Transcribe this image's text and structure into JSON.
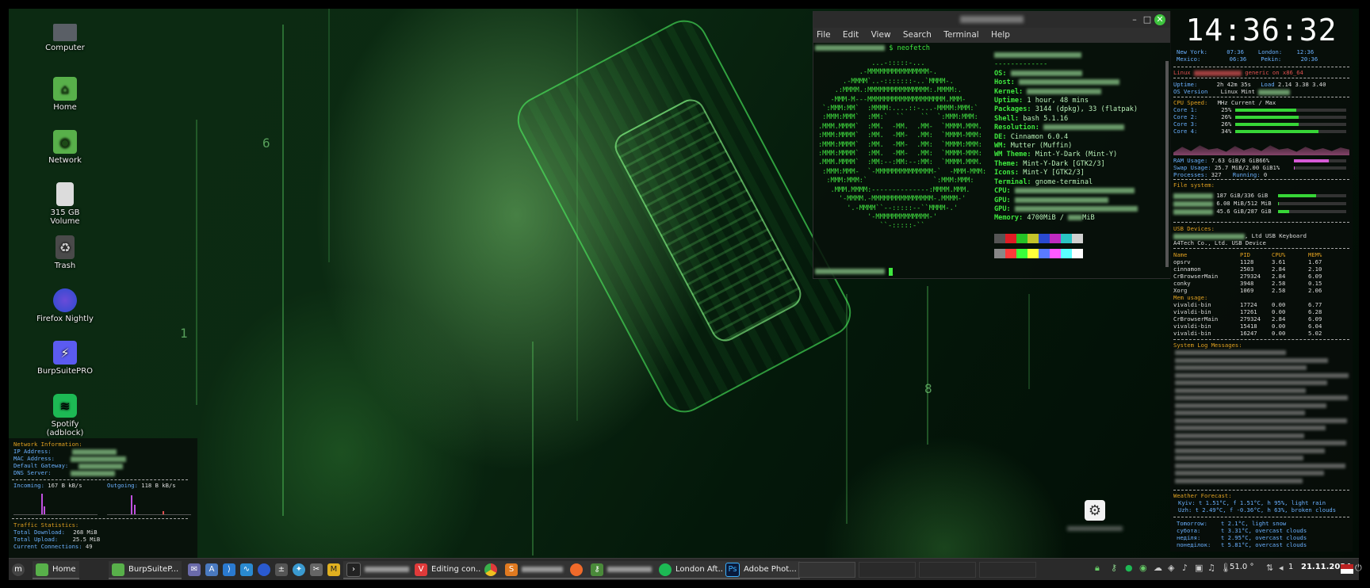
{
  "desktop": {
    "icons": [
      {
        "label": "Computer"
      },
      {
        "label": "Home"
      },
      {
        "label": "Network"
      },
      {
        "label": "315 GB Volume"
      },
      {
        "label": "Trash"
      },
      {
        "label": "Firefox Nightly"
      },
      {
        "label": "BurpSuitePRO"
      },
      {
        "label": "Spotify (adblock)"
      }
    ]
  },
  "terminal": {
    "menu": [
      "File",
      "Edit",
      "View",
      "Search",
      "Terminal",
      "Help"
    ],
    "command": "$ neofetch",
    "ascii": "             ...-:::::-...\n          .-MMMMMMMMMMMMMMM-.\n      .-MMMM`..-:::::::-..`MMMM-.\n    .:MMMM.:MMMMMMMMMMMMMMM:.MMMM:.\n   -MMM-M---MMMMMMMMMMMMMMMMMMM.MMM-\n `:MMM:MM`  :MMMM:....::-...-MMMM:MMM:`\n :MMM:MMM`  :MM:`  ``    ``  `:MMM:MMM:\n.MMM.MMMM`  :MM.  -MM.  .MM-  `MMMM.MMM.\n:MMM:MMMM`  :MM.  -MM-  .MM:  `MMMM-MMM:\n:MMM:MMMM`  :MM.  -MM-  .MM:  `MMMM:MMM:\n:MMM:MMMM`  :MM.  -MM-  .MM:  `MMMM-MMM:\n.MMM.MMMM`  :MM:--:MM:--:MM:  `MMMM.MMM.\n :MMM:MMM-  `-MMMMMMMMMMMMMM-`  -MMM-MMM:\n  :MMM:MMM:`                `:MMM:MMM:\n   .MMM.MMMM:--------------:MMMM.MMM.\n     '-MMMM.-MMMMMMMMMMMMMMM-.MMMM-'\n       '.-MMMM``--:::::--``MMMM-.'\n            '-MMMMMMMMMMMMM-'\n               ``-:::::-``",
    "info": [
      {
        "k": "OS:",
        "v": ""
      },
      {
        "k": "Host:",
        "v": ""
      },
      {
        "k": "Kernel:",
        "v": ""
      },
      {
        "k": "Uptime:",
        "v": "1 hour, 48 mins"
      },
      {
        "k": "Packages:",
        "v": "3144 (dpkg), 33 (flatpak)"
      },
      {
        "k": "Shell:",
        "v": "bash 5.1.16"
      },
      {
        "k": "Resolution:",
        "v": ""
      },
      {
        "k": "DE:",
        "v": "Cinnamon 6.0.4"
      },
      {
        "k": "WM:",
        "v": "Mutter (Muffin)"
      },
      {
        "k": "WM Theme:",
        "v": "Mint-Y-Dark (Mint-Y)"
      },
      {
        "k": "Theme:",
        "v": "Mint-Y-Dark [GTK2/3]"
      },
      {
        "k": "Icons:",
        "v": "Mint-Y [GTK2/3]"
      },
      {
        "k": "Terminal:",
        "v": "gnome-terminal"
      },
      {
        "k": "CPU:",
        "v": ""
      },
      {
        "k": "GPU:",
        "v": ""
      },
      {
        "k": "GPU:",
        "v": ""
      },
      {
        "k": "Memory:",
        "v": "4700MiB / "
      }
    ],
    "memory_suffix": "MiB",
    "palette": [
      "#555555",
      "#e01b24",
      "#26c226",
      "#c4c42a",
      "#2a4ad0",
      "#c02ac0",
      "#2ac4c4",
      "#d0d0d0"
    ],
    "palette2": [
      "#888888",
      "#ff3a3a",
      "#3aff3a",
      "#ffff3a",
      "#5a7aff",
      "#ff5aff",
      "#5affff",
      "#ffffff"
    ]
  },
  "conky_right": {
    "clock": "14:36:32",
    "cities": [
      {
        "name": "New York:",
        "time": "07:36",
        "name2": "London:",
        "time2": "12:36"
      },
      {
        "name": "Mexico:",
        "time": "06:36",
        "name2": "Pekin:",
        "time2": "20:36"
      }
    ],
    "kernel_prefix": "Linux",
    "kernel_suffix": "generic on x86_64",
    "uptime_label": "Uptime:",
    "uptime": "2h 42m 35s",
    "load_label": "Load",
    "load": "2.14 3.38 3.40",
    "os_label": "OS Version",
    "os": "Linux Mint",
    "cpu_header": "CPU Speed:",
    "cpu_cols": "MHz Current / Max",
    "cores": [
      {
        "name": "Core 1:",
        "pct": "25%",
        "fill": 0.25
      },
      {
        "name": "Core 2:",
        "pct": "26%",
        "fill": 0.26
      },
      {
        "name": "Core 3:",
        "pct": "26%",
        "fill": 0.26
      },
      {
        "name": "Core 4:",
        "pct": "34%",
        "fill": 0.34
      }
    ],
    "ram_label": "RAM Usage:",
    "ram": "7.63 GiB/",
    "ram_total": "8 GiB66%",
    "ram_fill": 0.66,
    "swap_label": "Swap Usage:",
    "swap": "25.7 MiB/2.00 GiB1%",
    "swap_fill": 0.01,
    "proc_label": "Processes:",
    "proc": "327",
    "running_label": "Running:",
    "running": "0",
    "fs_header": "File system:",
    "fs": [
      {
        "v": "187 GiB/336 GiB",
        "fill": 0.56
      },
      {
        "v": "6.08 MiB/512 MiB",
        "fill": 0.01
      },
      {
        "v": "45.6 GiB/287 GiB",
        "fill": 0.16
      }
    ],
    "usb_header": "USB Devices:",
    "usb": [
      ", Ltd USB Keyboard",
      "A4Tech Co., Ltd. USB Device"
    ],
    "proc_cols": [
      "Name",
      "PID",
      "CPU%",
      "MEM%"
    ],
    "proc_rows": [
      [
        "opsrv",
        "1128",
        "3.61",
        "1.67"
      ],
      [
        "cinnamon",
        "2503",
        "2.84",
        "2.10"
      ],
      [
        "CrBrowserMain",
        "279324",
        "2.84",
        "6.09"
      ],
      [
        "conky",
        "3948",
        "2.58",
        "0.15"
      ],
      [
        "Xorg",
        "1069",
        "2.58",
        "2.06"
      ]
    ],
    "mem_header": "Mem usage:",
    "mem_rows": [
      [
        "vivaldi-bin",
        "17724",
        "0.00",
        "6.77"
      ],
      [
        "vivaldi-bin",
        "17261",
        "0.00",
        "6.28"
      ],
      [
        "CrBrowserMain",
        "279324",
        "2.84",
        "6.09"
      ],
      [
        "vivaldi-bin",
        "15418",
        "0.00",
        "6.04"
      ],
      [
        "vivaldi-bin",
        "16247",
        "0.00",
        "5.02"
      ]
    ],
    "log_header": "System Log Messages:",
    "weather_header": "Weather Forecast:",
    "weather": [
      "Kyiv: t 1.51°C, f 1.51°C, h 95%, light rain",
      "Uzh: t 2.49°C, f -0.36°C, h 63%, broken clouds"
    ],
    "forecast": [
      [
        "Tomorrow:",
        "t 2.1°C, light snow"
      ],
      [
        "субота:",
        "t 3.31°C, overcast clouds"
      ],
      [
        "неділя:",
        "t 2.95°C, overcast clouds"
      ],
      [
        "понеділок:",
        "t 5.81°C, overcast clouds"
      ]
    ]
  },
  "conky_left": {
    "header": "Network Information:",
    "fields": [
      "IP Address:",
      "MAC Address:",
      "Default Gateway:",
      "DNS Server:"
    ],
    "incoming_label": "Incoming:",
    "incoming": "167 B kB/s",
    "outgoing_label": "Outgoing:",
    "outgoing": "118 B kB/s",
    "traffic_header": "Traffic Statistics:",
    "total_down_label": "Total Download:",
    "total_down": "268 MiB",
    "total_up_label": "Total Upload:",
    "total_up": "25.5 MiB",
    "conn_label": "Current Connections:",
    "conn": "49"
  },
  "taskbar": {
    "items": [
      {
        "label": "Home",
        "icon": "folder-icon"
      },
      {
        "label": "BurpSuiteP...",
        "icon": "folder-icon"
      },
      {
        "label": "",
        "icon": "terminal-icon"
      },
      {
        "label": "Editing con...",
        "icon": "vivaldi-icon"
      },
      {
        "label": "",
        "icon": "chrome-icon"
      },
      {
        "label": "",
        "icon": "sublime-icon"
      },
      {
        "label": "",
        "icon": "firefox-icon"
      },
      {
        "label": "",
        "icon": "key-icon"
      },
      {
        "label": "London Aft...",
        "icon": "spotify-icon"
      },
      {
        "label": "Adobe Phot...",
        "icon": "photoshop-icon"
      }
    ],
    "temperature": "51.0 °",
    "workspace": "1",
    "date": "21.11.2024"
  },
  "colors": {
    "accent": "#37d637",
    "header": "#e0a020",
    "taskbar": "#2a2a2a"
  }
}
